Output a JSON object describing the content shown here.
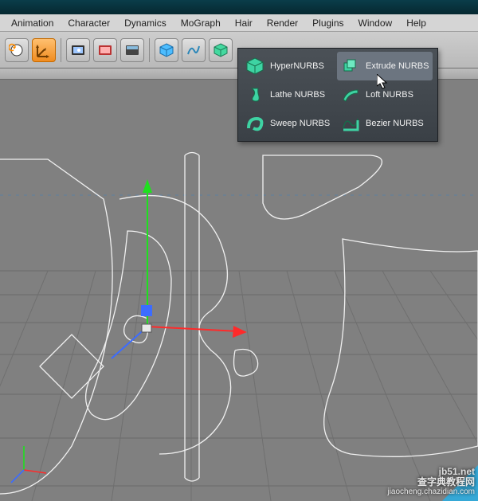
{
  "menus": {
    "animation": "Animation",
    "character": "Character",
    "dynamics": "Dynamics",
    "mograph": "MoGraph",
    "hair": "Hair",
    "render": "Render",
    "plugins": "Plugins",
    "window": "Window",
    "help": "Help"
  },
  "popup": {
    "hypernurbs": "HyperNURBS",
    "extrude": "Extrude NURBS",
    "lathe": "Lathe NURBS",
    "loft": "Loft NURBS",
    "sweep": "Sweep NURBS",
    "bezier": "Bezier NURBS"
  },
  "watermark": {
    "line1": "查字典教程网",
    "line2": "jiaocheng.chazidian.com"
  },
  "siteTag": "jb51.net"
}
